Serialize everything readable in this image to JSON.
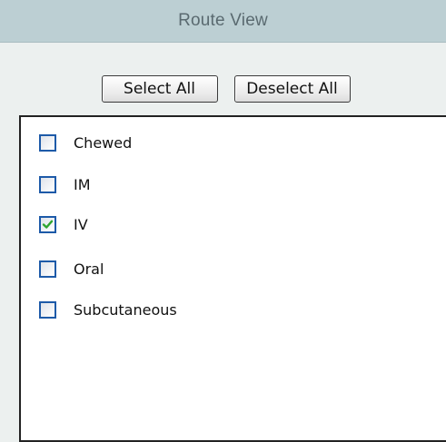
{
  "header": {
    "title": "Route View"
  },
  "toolbar": {
    "select_all_label": "Select All",
    "deselect_all_label": "Deselect All"
  },
  "routes": {
    "items": [
      {
        "label": "Chewed",
        "checked": false
      },
      {
        "label": "IM",
        "checked": false
      },
      {
        "label": "IV",
        "checked": true
      },
      {
        "label": "Oral",
        "checked": false
      },
      {
        "label": "Subcutaneous",
        "checked": false
      }
    ]
  },
  "colors": {
    "header_bg": "#bccfd3",
    "panel_bg": "#ecf0ef",
    "checkbox_border": "#1d5aa8",
    "check_mark": "#2fa52f"
  },
  "icons": {
    "check": "check-icon"
  }
}
